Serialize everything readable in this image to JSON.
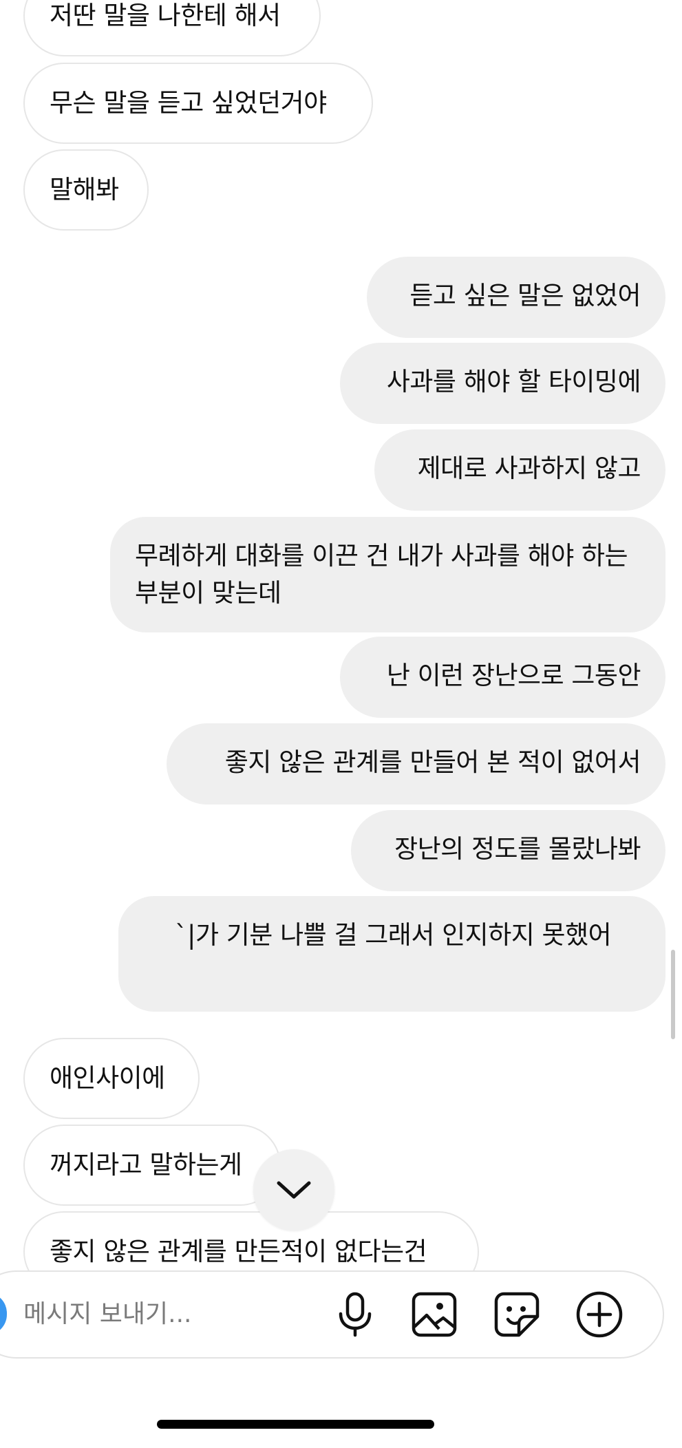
{
  "messages": [
    {
      "side": "incoming",
      "text": "저딴 말을 나한테 해서"
    },
    {
      "side": "incoming",
      "text": "무슨 말을 듣고 싶었던거야"
    },
    {
      "side": "incoming",
      "text": "말해봐"
    },
    {
      "side": "outgoing",
      "text": "듣고 싶은 말은 없었어"
    },
    {
      "side": "outgoing",
      "text": "사과를 해야 할 타이밍에"
    },
    {
      "side": "outgoing",
      "text": "제대로 사과하지 않고"
    },
    {
      "side": "outgoing",
      "text": "무례하게 대화를 이끈 건 내가 사과를 해야 하는 부분이 맞는데"
    },
    {
      "side": "outgoing",
      "text": "난 이런 장난으로 그동안"
    },
    {
      "side": "outgoing",
      "text": "좋지 않은 관계를 만들어 본 적이 없어서"
    },
    {
      "side": "outgoing",
      "text": "장난의 정도를 몰랐나봐"
    },
    {
      "side": "outgoing",
      "text": "`|가 기분 나쁠 걸 그래서 인지하지 못했어"
    },
    {
      "side": "incoming",
      "text": "애인사이에"
    },
    {
      "side": "incoming",
      "text": "꺼지라고 말하는게"
    },
    {
      "side": "incoming",
      "text": "좋지 않은 관계를 만든적이 없다는건"
    }
  ],
  "composer": {
    "placeholder": "메시지 보내기...",
    "icons": [
      "mic-icon",
      "gallery-icon",
      "sticker-icon",
      "plus-circle-icon"
    ]
  },
  "scroll_down": {
    "icon": "chevron-down-icon"
  },
  "colors": {
    "incoming_bg": "#ffffff",
    "incoming_border": "#e6e6e6",
    "outgoing_bg": "#efefef",
    "text": "#111111",
    "placeholder": "#7a7a7a",
    "accent": "#3897f0"
  }
}
